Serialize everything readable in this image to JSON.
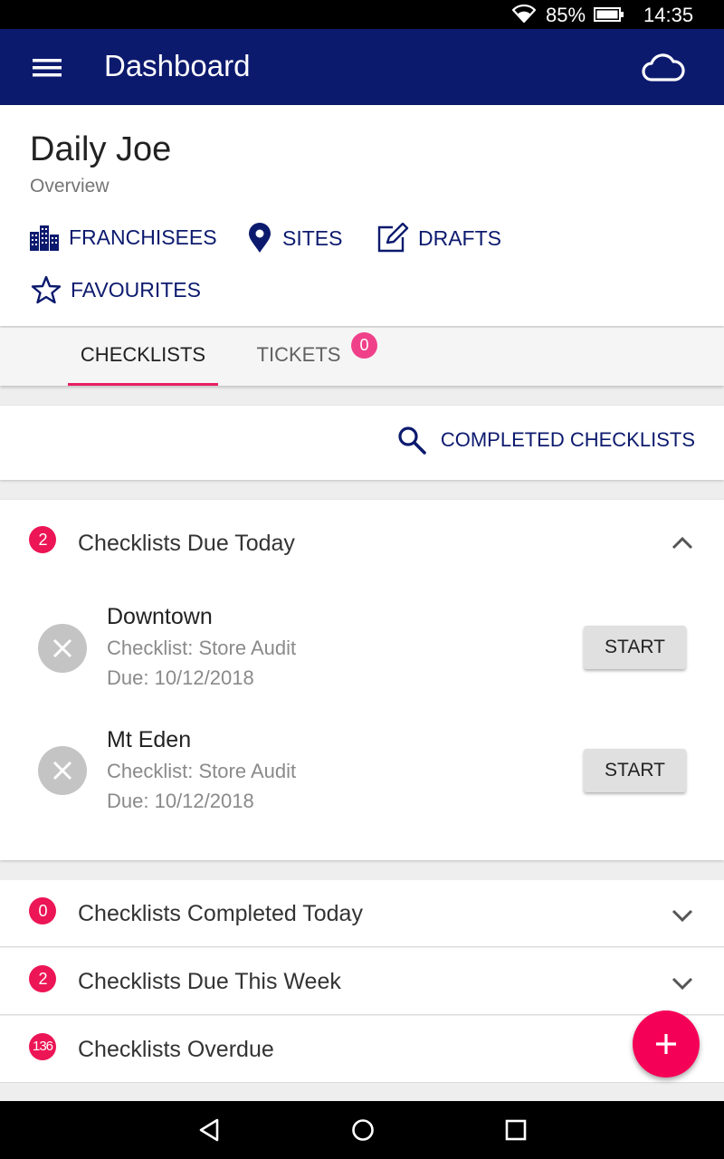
{
  "status_bar": {
    "battery": "85%",
    "time": "14:35"
  },
  "app_bar": {
    "title": "Dashboard",
    "menu_icon": "hamburger-menu-icon",
    "sync_icon": "cloud-icon"
  },
  "header": {
    "name": "Daily Joe",
    "subtitle": "Overview",
    "links": {
      "franchisees": "FRANCHISEES",
      "sites": "SITES",
      "drafts": "DRAFTS",
      "favourites": "FAVOURITES"
    }
  },
  "tabs": {
    "checklists": "CHECKLISTS",
    "tickets": "TICKETS",
    "tickets_badge": "0"
  },
  "completed_button": "COMPLETED CHECKLISTS",
  "sections": {
    "due_today": {
      "title": "Checklists Due Today",
      "count": "2",
      "items": [
        {
          "name": "Downtown",
          "checklist": "Checklist: Store Audit",
          "due": "Due: 10/12/2018",
          "action": "START"
        },
        {
          "name": "Mt Eden",
          "checklist": "Checklist: Store Audit",
          "due": "Due: 10/12/2018",
          "action": "START"
        }
      ]
    },
    "completed_today": {
      "title": "Checklists Completed Today",
      "count": "0"
    },
    "due_this_week": {
      "title": "Checklists Due This Week",
      "count": "2"
    },
    "overdue": {
      "title": "Checklists Overdue",
      "count": "136"
    }
  },
  "colors": {
    "primary": "#0c1a6e",
    "accent": "#f50057",
    "badge": "#ec1555",
    "tab_indicator": "#e91e63"
  }
}
